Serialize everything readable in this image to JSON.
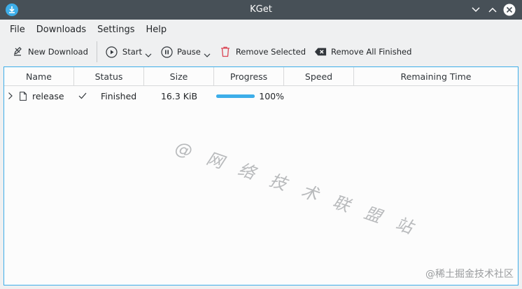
{
  "window": {
    "title": "KGet"
  },
  "menubar": {
    "items": [
      {
        "label": "File"
      },
      {
        "label": "Downloads"
      },
      {
        "label": "Settings"
      },
      {
        "label": "Help"
      }
    ]
  },
  "toolbar": {
    "new_download": "New Download",
    "start": "Start",
    "pause": "Pause",
    "remove_selected": "Remove Selected",
    "remove_all_finished": "Remove All Finished"
  },
  "table": {
    "columns": [
      "Name",
      "Status",
      "Size",
      "Progress",
      "Speed",
      "Remaining Time"
    ],
    "rows": [
      {
        "name": "release",
        "status": "Finished",
        "size": "16.3 KiB",
        "progress_label": "100%",
        "progress": 1.0,
        "speed": "",
        "remaining": ""
      }
    ]
  },
  "watermark": "@ 网 络 技 术 联 盟 站",
  "corner_mark": "@稀土掘金技术社区",
  "colors": {
    "titlebar": "#475057",
    "accent": "#3daee9",
    "remove_icon": "#da4453"
  }
}
